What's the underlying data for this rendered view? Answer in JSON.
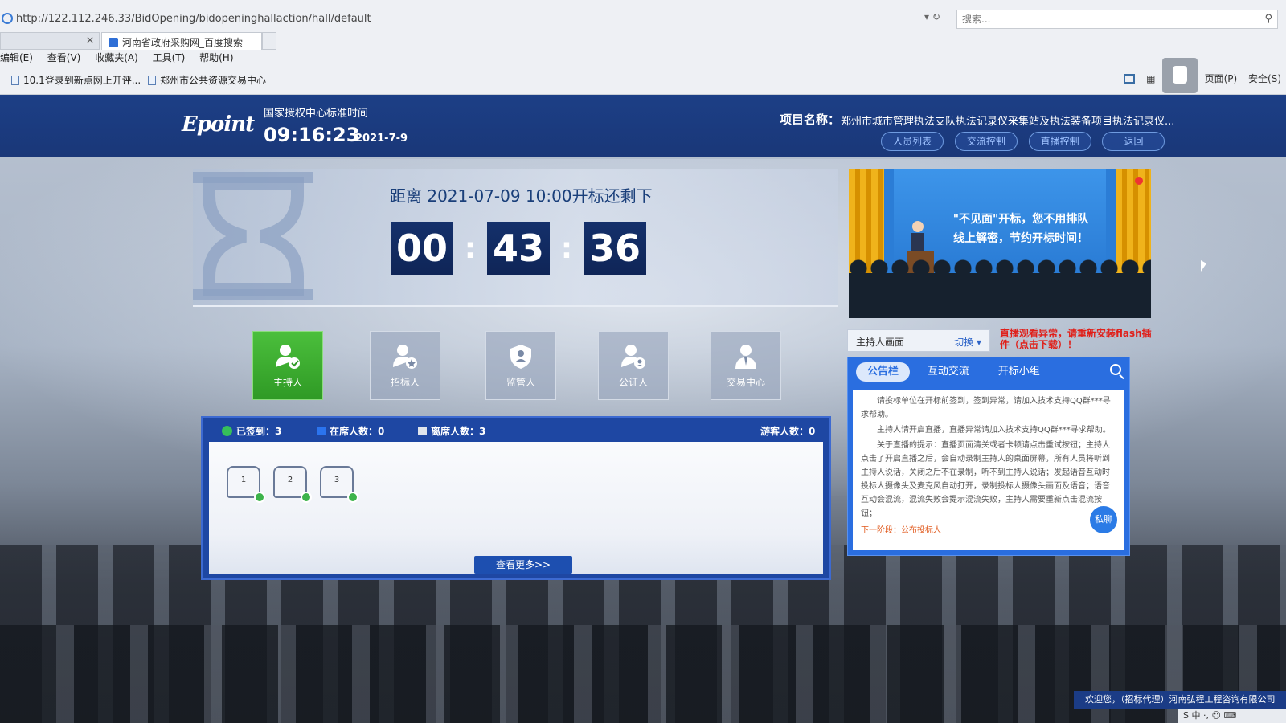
{
  "browser": {
    "url": "http://122.112.246.33/BidOpening/bidopeninghallaction/hall/default",
    "search_placeholder": "搜索...",
    "tabs": [
      {
        "label": "河南省政府采购网_百度搜索"
      }
    ],
    "menu": [
      "编辑(E)",
      "查看(V)",
      "收藏夹(A)",
      "工具(T)",
      "帮助(H)"
    ],
    "favorites": [
      "10.1登录到新点网上开评...",
      "郑州市公共资源交易中心"
    ],
    "toolbar_right": [
      "页面(P)",
      "安全(S)"
    ]
  },
  "header": {
    "logo": "Epoint",
    "time_label": "国家授权中心标准时间",
    "time": "09:16:23",
    "date": "2021-7-9",
    "project_label": "项目名称：",
    "project_name": "郑州市城市管理执法支队执法记录仪采集站及执法装备项目执法记录仪...",
    "buttons": [
      "人员列表",
      "交流控制",
      "直播控制",
      "返回"
    ]
  },
  "countdown": {
    "title": "距离 2021-07-09 10:00开标还剩下",
    "hours": "00",
    "minutes": "43",
    "seconds": "36"
  },
  "roles": [
    {
      "label": "主持人",
      "icon": "host-icon",
      "active": true
    },
    {
      "label": "招标人",
      "icon": "tenderer-icon",
      "active": false
    },
    {
      "label": "监管人",
      "icon": "supervisor-icon",
      "active": false
    },
    {
      "label": "公证人",
      "icon": "notary-icon",
      "active": false
    },
    {
      "label": "交易中心",
      "icon": "trade-center-icon",
      "active": false
    }
  ],
  "attendance": {
    "signed": "已签到：3",
    "present": "在席人数：0",
    "absent": "离席人数：3",
    "guests": "游客人数：0",
    "seats": [
      "1",
      "2",
      "3"
    ],
    "more": "查看更多>>"
  },
  "video": {
    "line1": "\"不见面\"开标，您不用排队",
    "line2": "线上解密，节约开标时间！",
    "camera_value": "主持人画面",
    "switch_label": "切换",
    "flash_warning": "直播观看异常，请重新安装flash插件（点击下载）！"
  },
  "notice": {
    "tabs": [
      "公告栏",
      "互动交流",
      "开标小组"
    ],
    "paragraphs": [
      "请投标单位在开标前签到，签到异常，请加入技术支持QQ群***寻求帮助。",
      "主持人请开启直播，直播异常请加入技术支持QQ群***寻求帮助。",
      "关于直播的提示：直播页面清关或者卡顿请点击重试按钮；主持人点击了开启直播之后，会自动录制主持人的桌面屏幕，所有人员将听到主持人说话，关闭之后不在录制，听不到主持人说话；发起语音互动时投标人摄像头及麦克风自动打开，录制投标人摄像头画面及语音；语音互动会混流，混流失败会提示混流失败，主持人需要重新点击混流按钮；"
    ],
    "next_stage": "下一阶段：公布投标人",
    "chat_label": "私聊"
  },
  "footer": {
    "welcome": "欢迎您，（招标代理）河南弘程工程咨询有限公司"
  },
  "colors": {
    "header_blue": "#1c3f86",
    "active_green": "#3aac2f",
    "countdown_box": "#14306b",
    "warning_red": "#e0201a"
  }
}
